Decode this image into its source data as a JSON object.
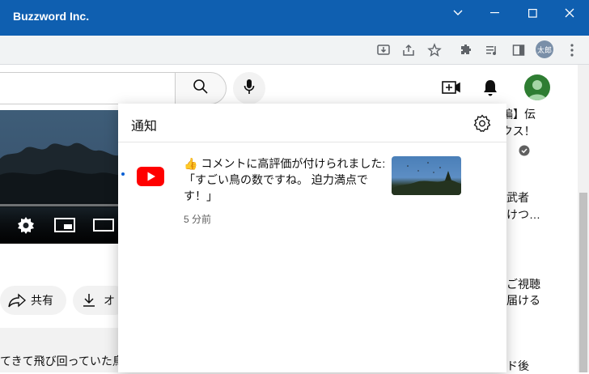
{
  "window": {
    "title": "Buzzword Inc.",
    "controls": [
      "chevron-down-icon",
      "minimize-icon",
      "maximize-icon",
      "close-icon"
    ]
  },
  "browser": {
    "profile_label": "太郎"
  },
  "right_column": {
    "line1": "編】伝",
    "line2": "クス！",
    "line3": "武者",
    "line4": "けつ…",
    "line5": "ご視聴",
    "line6": "届ける",
    "line7": "ド後"
  },
  "video_actions": {
    "share_label": "共有",
    "download_label": "オ"
  },
  "description_snippet": "てきて飛び回っていた鳥",
  "notifications": {
    "title": "通知",
    "items": [
      {
        "message": "👍 コメントに高評価が付けられました: 「すごい鳥の数ですね。 迫力満点です！」",
        "time": "5 分前",
        "unread": true
      }
    ]
  },
  "colors": {
    "titlebar": "#0f5fb0",
    "youtube_red": "#ff0000",
    "unread_dot": "#065fd4",
    "avatar_green": "#2e7d32"
  }
}
